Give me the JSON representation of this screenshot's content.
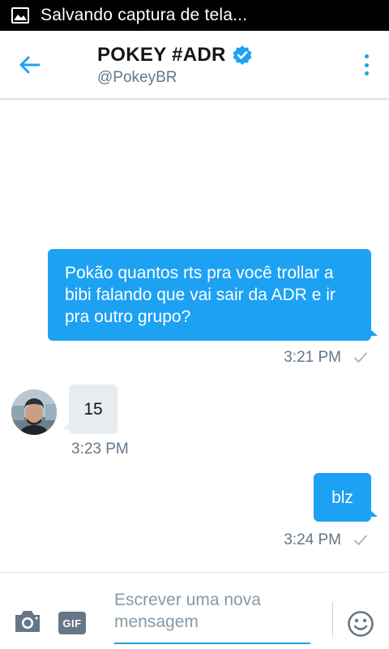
{
  "status_bar": {
    "text": "Salvando captura de tela...",
    "icon": "image-icon"
  },
  "header": {
    "title": "POKEY #ADR",
    "handle": "@PokeyBR",
    "verified": true,
    "back_icon": "arrow-left-icon",
    "more_icon": "more-vertical-icon",
    "accent_color": "#1da1f2"
  },
  "messages": [
    {
      "direction": "outgoing",
      "text": "Pokão quantos rts pra você trollar a bibi falando que vai sair da ADR e ir pra outro grupo?",
      "time": "3:21 PM",
      "read_receipt": "check-icon"
    },
    {
      "direction": "incoming",
      "text": "15",
      "time": "3:23 PM",
      "avatar": "avatar"
    },
    {
      "direction": "outgoing",
      "text": "blz",
      "time": "3:24 PM",
      "read_receipt": "check-icon"
    }
  ],
  "compose": {
    "placeholder": "Escrever uma nova mensagem",
    "gif_label": "GIF",
    "camera_icon": "camera-icon",
    "emoji_icon": "emoji-icon"
  },
  "colors": {
    "outgoing_bubble": "#1da1f2",
    "incoming_bubble": "#e6ecf0",
    "meta_text": "#657786"
  }
}
